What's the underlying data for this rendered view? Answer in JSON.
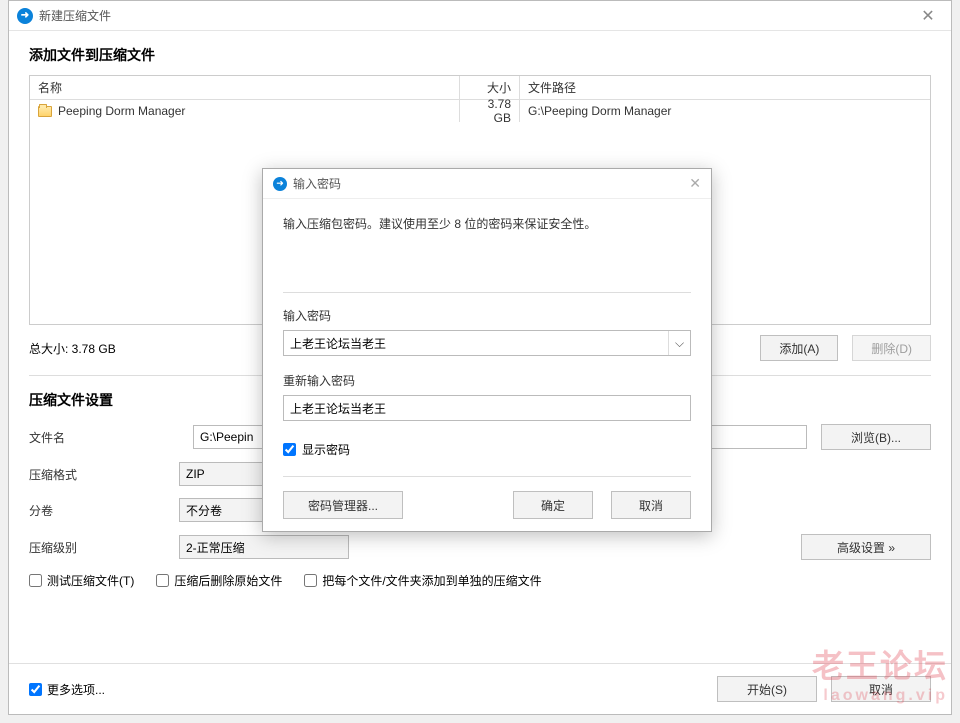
{
  "window": {
    "title": "新建压缩文件",
    "section_title": "添加文件到压缩文件"
  },
  "columns": {
    "name": "名称",
    "size": "大小",
    "path": "文件路径"
  },
  "files": [
    {
      "name": "Peeping Dorm Manager",
      "size": "3.78 GB",
      "path": "G:\\Peeping Dorm Manager"
    }
  ],
  "total": {
    "label": "总大小: 3.78 GB"
  },
  "buttons": {
    "add": "添加(A)",
    "delete": "删除(D)",
    "browse": "浏览(B)...",
    "advanced": "高级设置 »",
    "start": "开始(S)",
    "cancel": "取消"
  },
  "settings": {
    "title": "压缩文件设置",
    "filename_label": "文件名",
    "filename_value": "G:\\Peepin",
    "format_label": "压缩格式",
    "format_value": "ZIP",
    "split_label": "分卷",
    "split_value": "不分卷",
    "level_label": "压缩级别",
    "level_value": "2-正常压缩"
  },
  "checks": {
    "test": "测试压缩文件(T)",
    "delete_after": "压缩后删除原始文件",
    "separate": "把每个文件/文件夹添加到单独的压缩文件",
    "more": "更多选项..."
  },
  "modal": {
    "title": "输入密码",
    "hint": "输入压缩包密码。建议使用至少 8 位的密码来保证安全性。",
    "pw_label": "输入密码",
    "pw_value": "上老王论坛当老王",
    "pw2_label": "重新输入密码",
    "pw2_value": "上老王论坛当老王",
    "show_pw": "显示密码",
    "manager": "密码管理器...",
    "ok": "确定",
    "cancel": "取消"
  },
  "watermark": {
    "main": "老王论坛",
    "sub": "laowang.vip"
  }
}
